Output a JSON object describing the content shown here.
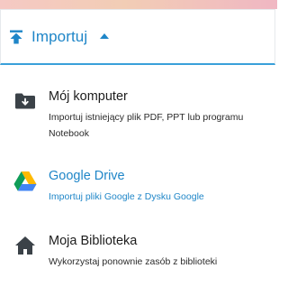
{
  "header": {
    "title": "Importuj",
    "icon": "upload-arrow-icon",
    "caret_icon": "caret-up-icon"
  },
  "items": [
    {
      "icon": "folder-download-icon",
      "title": "Mój komputer",
      "description": "Importuj istniejący plik PDF, PPT lub programu Notebook"
    },
    {
      "icon": "google-drive-icon",
      "title": "Google Drive",
      "description": "Importuj pliki Google z Dysku Google"
    },
    {
      "icon": "home-icon",
      "title": "Moja Biblioteka",
      "description": "Wykorzystaj ponownie zasób z biblioteki"
    }
  ],
  "colors": {
    "accent": "#1f86c8",
    "text": "#1d1d1d",
    "icon_dark": "#3b4248"
  }
}
